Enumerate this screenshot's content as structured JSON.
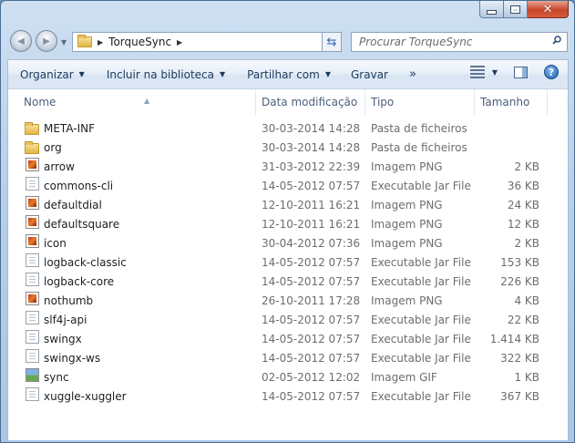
{
  "window": {
    "min_label": "minimize",
    "max_label": "maximize",
    "close_glyph": "✕"
  },
  "nav": {
    "back_glyph": "◀",
    "forward_glyph": "▶"
  },
  "address": {
    "path": "TorqueSync"
  },
  "search": {
    "placeholder": "Procurar TorqueSync"
  },
  "toolbar": {
    "organize": "Organizar",
    "include_library": "Incluir na biblioteca",
    "share_with": "Partilhar com",
    "burn": "Gravar",
    "more": "»"
  },
  "columns": {
    "name": "Nome",
    "date": "Data modificação",
    "type": "Tipo",
    "size": "Tamanho"
  },
  "files": [
    {
      "name": "META-INF",
      "date": "30-03-2014 14:28",
      "type": "Pasta de ficheiros",
      "size": "",
      "icon": "folder-icon"
    },
    {
      "name": "org",
      "date": "30-03-2014 14:28",
      "type": "Pasta de ficheiros",
      "size": "",
      "icon": "folder-icon"
    },
    {
      "name": "arrow",
      "date": "31-03-2012 22:39",
      "type": "Imagem PNG",
      "size": "2 KB",
      "icon": "png-file-icon"
    },
    {
      "name": "commons-cli",
      "date": "14-05-2012 07:57",
      "type": "Executable Jar File",
      "size": "36 KB",
      "icon": "jar-file-icon"
    },
    {
      "name": "defaultdial",
      "date": "12-10-2011 16:21",
      "type": "Imagem PNG",
      "size": "24 KB",
      "icon": "png-file-icon"
    },
    {
      "name": "defaultsquare",
      "date": "12-10-2011 16:21",
      "type": "Imagem PNG",
      "size": "12 KB",
      "icon": "png-file-icon"
    },
    {
      "name": "icon",
      "date": "30-04-2012 07:36",
      "type": "Imagem PNG",
      "size": "2 KB",
      "icon": "png-file-icon"
    },
    {
      "name": "logback-classic",
      "date": "14-05-2012 07:57",
      "type": "Executable Jar File",
      "size": "153 KB",
      "icon": "jar-file-icon"
    },
    {
      "name": "logback-core",
      "date": "14-05-2012 07:57",
      "type": "Executable Jar File",
      "size": "226 KB",
      "icon": "jar-file-icon"
    },
    {
      "name": "nothumb",
      "date": "26-10-2011 17:28",
      "type": "Imagem PNG",
      "size": "4 KB",
      "icon": "png-file-icon"
    },
    {
      "name": "slf4j-api",
      "date": "14-05-2012 07:57",
      "type": "Executable Jar File",
      "size": "22 KB",
      "icon": "jar-file-icon"
    },
    {
      "name": "swingx",
      "date": "14-05-2012 07:57",
      "type": "Executable Jar File",
      "size": "1.414 KB",
      "icon": "jar-file-icon"
    },
    {
      "name": "swingx-ws",
      "date": "14-05-2012 07:57",
      "type": "Executable Jar File",
      "size": "322 KB",
      "icon": "jar-file-icon"
    },
    {
      "name": "sync",
      "date": "02-05-2012 12:02",
      "type": "Imagem GIF",
      "size": "1 KB",
      "icon": "gif-file-icon"
    },
    {
      "name": "xuggle-xuggler",
      "date": "14-05-2012 07:57",
      "type": "Executable Jar File",
      "size": "367 KB",
      "icon": "jar-file-icon"
    }
  ]
}
